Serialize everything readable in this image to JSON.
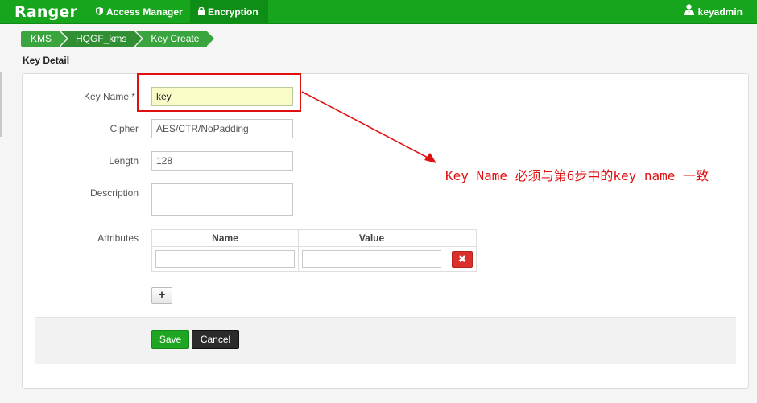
{
  "navbar": {
    "brand": "Ranger",
    "items": [
      {
        "label": "Access Manager",
        "icon": "shield-icon"
      },
      {
        "label": "Encryption",
        "icon": "lock-icon"
      }
    ],
    "user": {
      "name": "keyadmin",
      "icon": "user-icon"
    }
  },
  "breadcrumb": [
    "KMS",
    "HQGF_kms",
    "Key Create"
  ],
  "page": {
    "title": "Key Detail"
  },
  "form": {
    "key_name": {
      "label": "Key Name *",
      "value": "key"
    },
    "cipher": {
      "label": "Cipher",
      "value": "AES/CTR/NoPadding"
    },
    "length": {
      "label": "Length",
      "value": "128"
    },
    "description": {
      "label": "Description",
      "value": ""
    },
    "attributes": {
      "label": "Attributes",
      "columns": [
        "Name",
        "Value"
      ],
      "rows": [
        {
          "name": "",
          "value": ""
        }
      ]
    }
  },
  "buttons": {
    "add": "+",
    "delete": "✖",
    "save": "Save",
    "cancel": "Cancel"
  },
  "annotation": {
    "text": "Key Name 必须与第6步中的key name 一致",
    "color": "#e01010"
  },
  "colors": {
    "navbar": "#16a51d",
    "breadcrumb": "#3aa43e",
    "save": "#1ea622",
    "danger": "#d9302c"
  }
}
